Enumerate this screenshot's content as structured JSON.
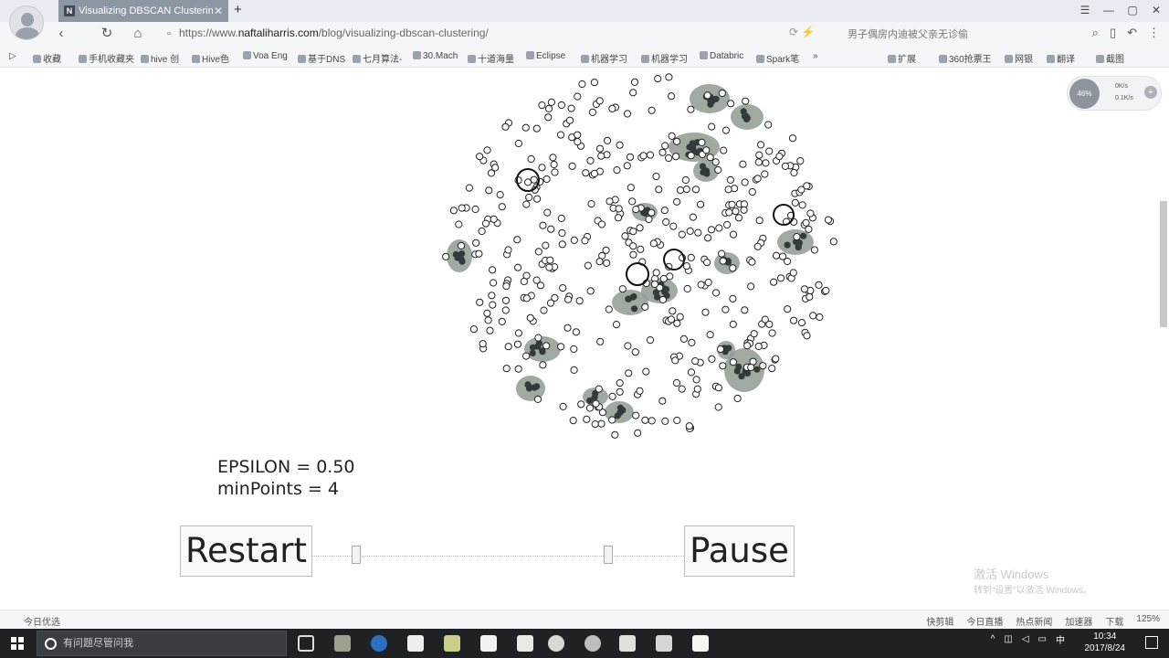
{
  "tabbar": {
    "tab_title": "Visualizing DBSCAN Clusterin",
    "tab_favicon": "N",
    "close_glyph": "✕",
    "new_tab_glyph": "+"
  },
  "navbar": {
    "url_prefix": "https://www.",
    "url_host": "naftaliharris.com",
    "url_path": "/blog/visualizing-dbscan-clustering/",
    "hot_search": "男子偶房内迪被父亲无诊偷"
  },
  "bookmarks": [
    "收藏",
    "手机收藏夹",
    "hive 创",
    "Hive色",
    "Voa Eng",
    "基于DNS",
    "七月算法-",
    "30.Mach",
    "十道海量",
    "Eclipse",
    "机器学习",
    "机器学习",
    "Databric",
    "Spark笔",
    "扩展",
    "360抢票王",
    "网银",
    "翻译",
    "截图"
  ],
  "visualization": {
    "epsilon_label": "EPSILON = 0.50",
    "minpoints_label": "minPoints = 4",
    "restart_label": "Restart",
    "pause_label": "Pause"
  },
  "net_widget": {
    "percent": "46%",
    "up_speed": "0K/s",
    "down_speed": "0.1K/s"
  },
  "watermark": {
    "line1": "激活 Windows",
    "line2": "转到“设置”以激活 Windows。"
  },
  "statusbar": {
    "left": "今日优选",
    "items": [
      "快剪辑",
      "今日直播",
      "热点新闻",
      "加速器",
      "下载",
      "125%"
    ]
  },
  "taskbar": {
    "search_placeholder": "有问题尽管问我",
    "time": "10:34",
    "date": "2017/8/24",
    "ime": "中"
  },
  "colors": {
    "cluster_fill": "#8f9b8f",
    "core_point": "#333a3a",
    "point_outline": "#222222"
  }
}
